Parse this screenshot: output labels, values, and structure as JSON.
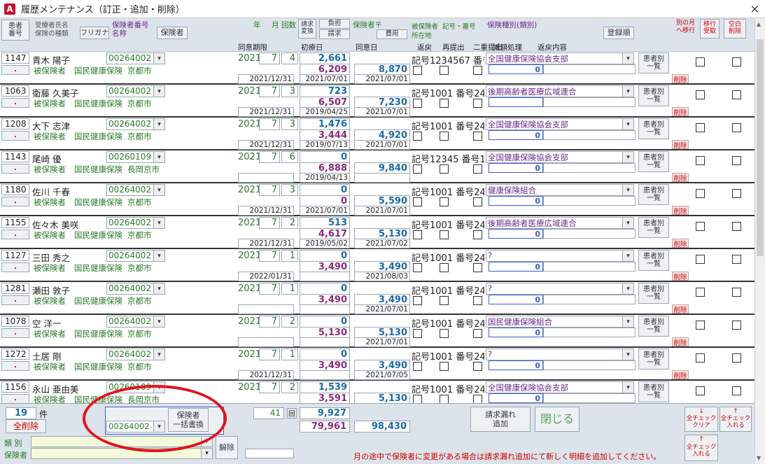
{
  "window": {
    "title": "履歴メンテナンス（訂正・追加・削除）",
    "app_icon": "A",
    "close": "×"
  },
  "header": {
    "btn_patient_no": "患者\n番号",
    "label_name": "受療者氏名",
    "label_insurance_type": "保険の種類",
    "btn_furigana": "フリガナ",
    "label_insurer_no": "保険者番号",
    "label_name2": "名称",
    "btn_insurer": "保険者",
    "label_year": "年",
    "label_month": "月",
    "label_count": "回数",
    "btn_claim_change": "請求\n変換",
    "label_burden": "負担",
    "btn_claim": "請求",
    "label_insurer_zip": "保険者〒",
    "btn_fee": "費用",
    "label_insured": "被保険者",
    "label_symbol_no": "記号・番号",
    "label_insurance_kind": "保険種別(類別)",
    "label_address": "所在地",
    "btn_register_order": "登録順",
    "label_other_month": "別の月\nへ移行",
    "btn_transfer_receive": "移行\n受取",
    "btn_empty_delete": "空白\n削除",
    "label_consent_period": "同意期限",
    "label_first_visit": "初療日",
    "label_consent_date": "同意日",
    "label_return": "返戻",
    "label_resubmit": "再提出",
    "label_double": "二重提出",
    "label_reduction": "減額処理",
    "label_return_content": "返戻内容"
  },
  "rows": [
    {
      "id": "1147",
      "name": "青木 陽子",
      "ins_no": "00264002",
      "role": "被保険者",
      "type": "国民健康保険",
      "place": "京都市",
      "year": "2021",
      "month": "7",
      "count": "4",
      "amt1": "2,661",
      "amt2": "6,209",
      "amt3": "8,870",
      "consent_limit": "2021/12/31",
      "first_date": "2021/07/01",
      "consent_date": "2021/07/01",
      "code": "記号1234567 番号",
      "inst": "全国健康保険協会支部",
      "reduce": "0",
      "pat_btn": "患者別\n一覧",
      "del": "削除"
    },
    {
      "id": "1063",
      "name": "衛藤 久美子",
      "ins_no": "00264002",
      "role": "被保険者",
      "type": "国民健康保険",
      "place": "京都市",
      "year": "2021",
      "month": "7",
      "count": "3",
      "amt1": "723",
      "amt2": "6,507",
      "amt3": "7,230",
      "consent_limit": "2021/12/31",
      "first_date": "2019/04/25",
      "consent_date": "2021/07/01",
      "code": "記号1001 番号246",
      "inst": "後期高齢者医療広域連合",
      "reduce": "",
      "pat_btn": "患者別\n一覧",
      "del": "削除"
    },
    {
      "id": "1208",
      "name": "大下 志津",
      "ins_no": "00264002",
      "role": "被保険者",
      "type": "国民健康保険",
      "place": "京都市",
      "year": "2021",
      "month": "7",
      "count": "3",
      "amt1": "1,476",
      "amt2": "3,444",
      "amt3": "4,920",
      "consent_limit": "2021/12/31",
      "first_date": "2019/07/13",
      "consent_date": "2021/07/01",
      "code": "記号1001 番号246",
      "inst": "全国健康保険協会支部",
      "reduce": "0",
      "pat_btn": "患者別\n一覧",
      "del": "削除"
    },
    {
      "id": "1143",
      "name": "尾崎 優",
      "ins_no": "00260109",
      "role": "被保険者",
      "type": "国民健康保険",
      "place": "長岡京市",
      "year": "2021",
      "month": "7",
      "count": "6",
      "amt1": "0",
      "amt2": "6,888",
      "amt3": "9,840",
      "consent_limit": "",
      "first_date": "2019/04/13",
      "consent_date": "",
      "code": "記号12345 番号14",
      "inst": "全国健康保険協会支部",
      "reduce": "0",
      "pat_btn": "患者別\n一覧",
      "del": "削除"
    },
    {
      "id": "1180",
      "name": "佐川 千春",
      "ins_no": "00264002",
      "role": "被保険者",
      "type": "国民健康保険",
      "place": "京都市",
      "year": "2021",
      "month": "7",
      "count": "3",
      "amt1": "0",
      "amt2": "0",
      "amt3": "5,590",
      "consent_limit": "2021/12/31",
      "first_date": "2021/07/01",
      "consent_date": "2021/07/01",
      "code": "記号1001 番号246",
      "inst": "健康保険組合",
      "reduce": "0",
      "pat_btn": "患者別\n一覧",
      "del": "削除"
    },
    {
      "id": "1155",
      "name": "佐々木 美咲",
      "ins_no": "00264002",
      "role": "被保険者",
      "type": "国民健康保険",
      "place": "京都市",
      "year": "2021",
      "month": "7",
      "count": "2",
      "amt1": "513",
      "amt2": "4,617",
      "amt3": "5,130",
      "consent_limit": "2021/12/31",
      "first_date": "2019/05/02",
      "consent_date": "2021/07/02",
      "code": "記号1001 番号246",
      "inst": "後期高齢者医療広域連合",
      "reduce": "0",
      "pat_btn": "患者別\n一覧",
      "del": "削除"
    },
    {
      "id": "1127",
      "name": "三田 秀之",
      "ins_no": "00264002",
      "role": "被保険者",
      "type": "国民健康保険",
      "place": "京都市",
      "year": "2021",
      "month": "7",
      "count": "1",
      "amt1": "0",
      "amt2": "3,490",
      "amt3": "3,490",
      "consent_limit": "2022/01/31",
      "first_date": "",
      "consent_date": "2021/08/03",
      "code": "記号1001 番号246",
      "inst": "?",
      "reduce": "0",
      "pat_btn": "患者別\n一覧",
      "del": "削除"
    },
    {
      "id": "1281",
      "name": "瀬田 敦子",
      "ins_no": "00264002",
      "role": "被保険者",
      "type": "国民健康保険",
      "place": "京都市",
      "year": "2021",
      "month": "7",
      "count": "1",
      "amt1": "0",
      "amt2": "3,490",
      "amt3": "3,490",
      "consent_limit": "",
      "first_date": "",
      "consent_date": "2021/07/01",
      "code": "記号1001 番号246",
      "inst": "?",
      "reduce": "0",
      "pat_btn": "患者別\n一覧",
      "del": "削除"
    },
    {
      "id": "1078",
      "name": "空 洋一",
      "ins_no": "00264002",
      "role": "被保険者",
      "type": "国民健康保険",
      "place": "京都市",
      "year": "2021",
      "month": "7",
      "count": "2",
      "amt1": "0",
      "amt2": "5,130",
      "amt3": "5,130",
      "consent_limit": "",
      "first_date": "",
      "consent_date": "2021/07/01",
      "code": "記号1001 番号246",
      "inst": "国民健康保険組合",
      "reduce": "0",
      "pat_btn": "患者別\n一覧",
      "del": "削除"
    },
    {
      "id": "1272",
      "name": "土居 剛",
      "ins_no": "00264002",
      "role": "被保険者",
      "type": "国民健康保険",
      "place": "京都市",
      "year": "2021",
      "month": "7",
      "count": "1",
      "amt1": "0",
      "amt2": "3,490",
      "amt3": "3,490",
      "consent_limit": "2021/12/31",
      "first_date": "",
      "consent_date": "2021/07/05",
      "code": "記号1001 番号246",
      "inst": "?",
      "reduce": "0",
      "pat_btn": "患者別\n一覧",
      "del": "削除"
    },
    {
      "id": "1156",
      "name": "永山 亜由美",
      "ins_no": "00260109",
      "role": "被保険者",
      "type": "国民健康保険",
      "place": "長岡京市",
      "year": "2021",
      "month": "7",
      "count": "2",
      "amt1": "1,539",
      "amt2": "3,591",
      "amt3": "5,130",
      "consent_limit": "",
      "first_date": "",
      "consent_date": "",
      "code": "記号1001 番号246",
      "inst": "全国健康保険協会支部",
      "reduce": "0",
      "pat_btn": "患者別\n一覧",
      "del": "削除"
    }
  ],
  "footer": {
    "count": "19",
    "count_unit": "件",
    "btn_delete_all": "全削除",
    "bulk_ins_no": "00264002",
    "btn_bulk_insurer": "保険者\n一括書換",
    "total_visits": "41",
    "visits_unit": "回",
    "total1": "9,927",
    "total2": "79,961",
    "total3": "98,430",
    "btn_claim_missing": "請求漏れ\n追加",
    "btn_close": "閉じる",
    "btn_check_clear": "全チェック\nクリア",
    "btn_check_in1": "全チェック\n入れる",
    "btn_check_in2": "全チェック\n入れる",
    "label_kind": "類 別",
    "label_insurer": "保険者",
    "btn_release": "解除",
    "notice": "月の途中で保険者に変更がある場合は請求漏れ追加にて新しく明細を追加してください。"
  },
  "colors": {
    "accent_red": "#e0141e",
    "green": "#2c7a2c",
    "purple": "#6a2a8a",
    "blue": "#1a6aa6"
  }
}
